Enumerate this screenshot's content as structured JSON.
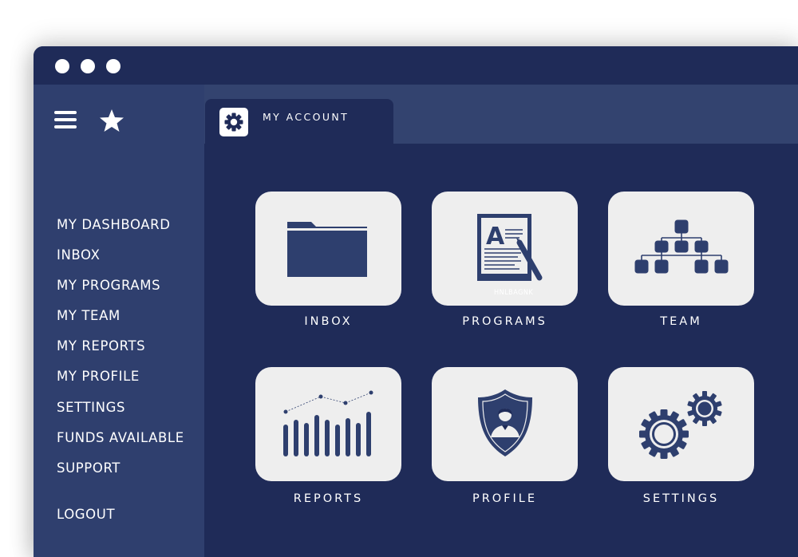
{
  "window": {
    "controls": [
      "dot",
      "dot",
      "dot"
    ]
  },
  "sidebar": {
    "menu_icon": "hamburger-menu-icon",
    "favorite_icon": "star-icon",
    "items": [
      {
        "label": "MY DASHBOARD"
      },
      {
        "label": "INBOX"
      },
      {
        "label": "MY PROGRAMS"
      },
      {
        "label": "MY TEAM"
      },
      {
        "label": "MY REPORTS"
      },
      {
        "label": "MY PROFILE"
      },
      {
        "label": "SETTINGS"
      },
      {
        "label": "FUNDS AVAILABLE"
      },
      {
        "label": "SUPPORT"
      }
    ],
    "logout_label": "LOGOUT"
  },
  "tab": {
    "label": "MY ACCOUNT",
    "icon": "gear-icon"
  },
  "tiles": [
    {
      "label": "INBOX",
      "icon": "folder-icon"
    },
    {
      "label": "PROGRAMS",
      "icon": "document-pen-icon",
      "icon_caption": "HNLBAGNK"
    },
    {
      "label": "TEAM",
      "icon": "org-chart-icon"
    },
    {
      "label": "REPORTS",
      "icon": "bar-chart-icon"
    },
    {
      "label": "PROFILE",
      "icon": "user-shield-icon"
    },
    {
      "label": "SETTINGS",
      "icon": "gears-icon"
    }
  ],
  "colors": {
    "window_bg": "#1f2b58",
    "sidebar_bg": "#2f3f6e",
    "tabstrip_bg": "#33436f",
    "tile_bg": "#eeeeee",
    "icon_color": "#2e3f6e",
    "text": "#ffffff"
  }
}
